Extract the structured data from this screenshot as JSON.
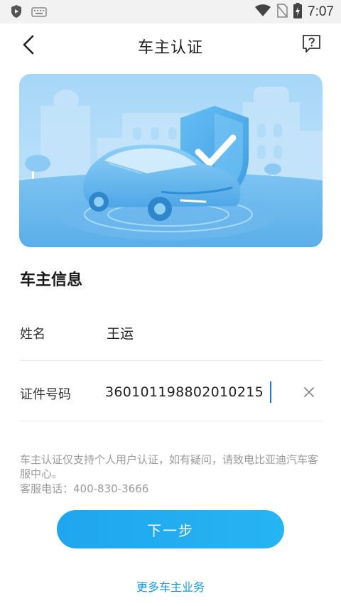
{
  "status_bar": {
    "time": "7:07",
    "icons": [
      "shield-app-icon",
      "keyboard-icon",
      "wifi-icon",
      "no-sim-icon",
      "battery-charging-icon"
    ]
  },
  "header": {
    "title": "车主认证",
    "back_icon": "chevron-left-icon",
    "help_icon": "help-question-icon"
  },
  "banner": {
    "illustration": "car-with-shield-checkmark"
  },
  "owner_info": {
    "section_title": "车主信息",
    "name_label": "姓名",
    "name_value": "王运",
    "id_label": "证件号码",
    "id_value": "360101198802010215",
    "clear_icon": "close-x-icon"
  },
  "notice": {
    "text": "车主认证仅支持个人用户认证，如有疑问，请致电比亚迪汽车客服中心。",
    "phone": "客服电话：400-830-3666"
  },
  "actions": {
    "next_label": "下一步",
    "more_label": "更多车主业务"
  },
  "colors": {
    "accent": "#1fa6ee",
    "link": "#1a9be6",
    "banner_bg": "#a8daf8"
  }
}
